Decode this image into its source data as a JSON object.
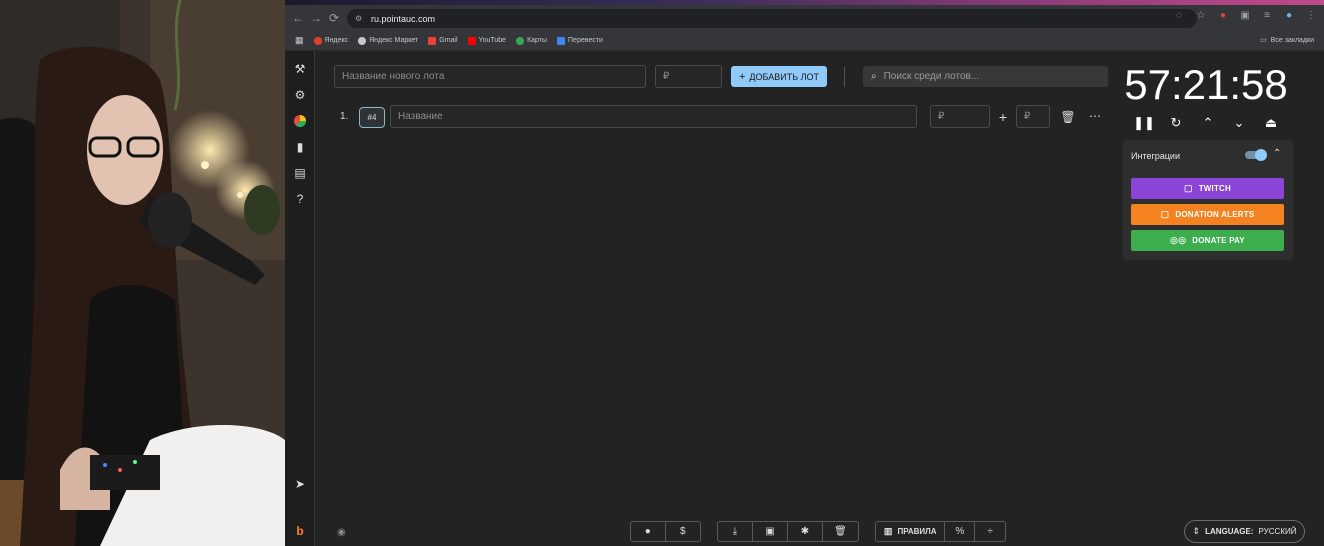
{
  "browser": {
    "url": "ru.pointauc.com",
    "bookmarks": [
      "Яндекс",
      "Яндекс Маркет",
      "Gmail",
      "YouTube",
      "Карты",
      "Перевести"
    ],
    "all_bookmarks": "Все закладки"
  },
  "toolbar": {
    "new_lot_placeholder": "Название нового лота",
    "currency": "₽",
    "add_lot_label": "ДОБАВИТЬ ЛОТ",
    "search_placeholder": "Поиск среди лотов..."
  },
  "lots": [
    {
      "index": "1.",
      "id": "#4",
      "name_placeholder": "Название",
      "amount_placeholder": "₽",
      "add_placeholder": "₽"
    }
  ],
  "timer": {
    "value": "57:21:58"
  },
  "integrations": {
    "title": "Интеграции",
    "enabled": true,
    "buttons": [
      {
        "label": "TWITCH",
        "color": "#8a44d6"
      },
      {
        "label": "DONATION ALERTS",
        "color": "#f58220"
      },
      {
        "label": "DONATE PAY",
        "color": "#3cae4e"
      }
    ]
  },
  "footer": {
    "rules_label": "ПРАВИЛА",
    "language_label": "LANGUAGE:",
    "language_value": "РУССКИЙ"
  },
  "colors": {
    "accent": "#90caf9",
    "background": "#232323"
  }
}
